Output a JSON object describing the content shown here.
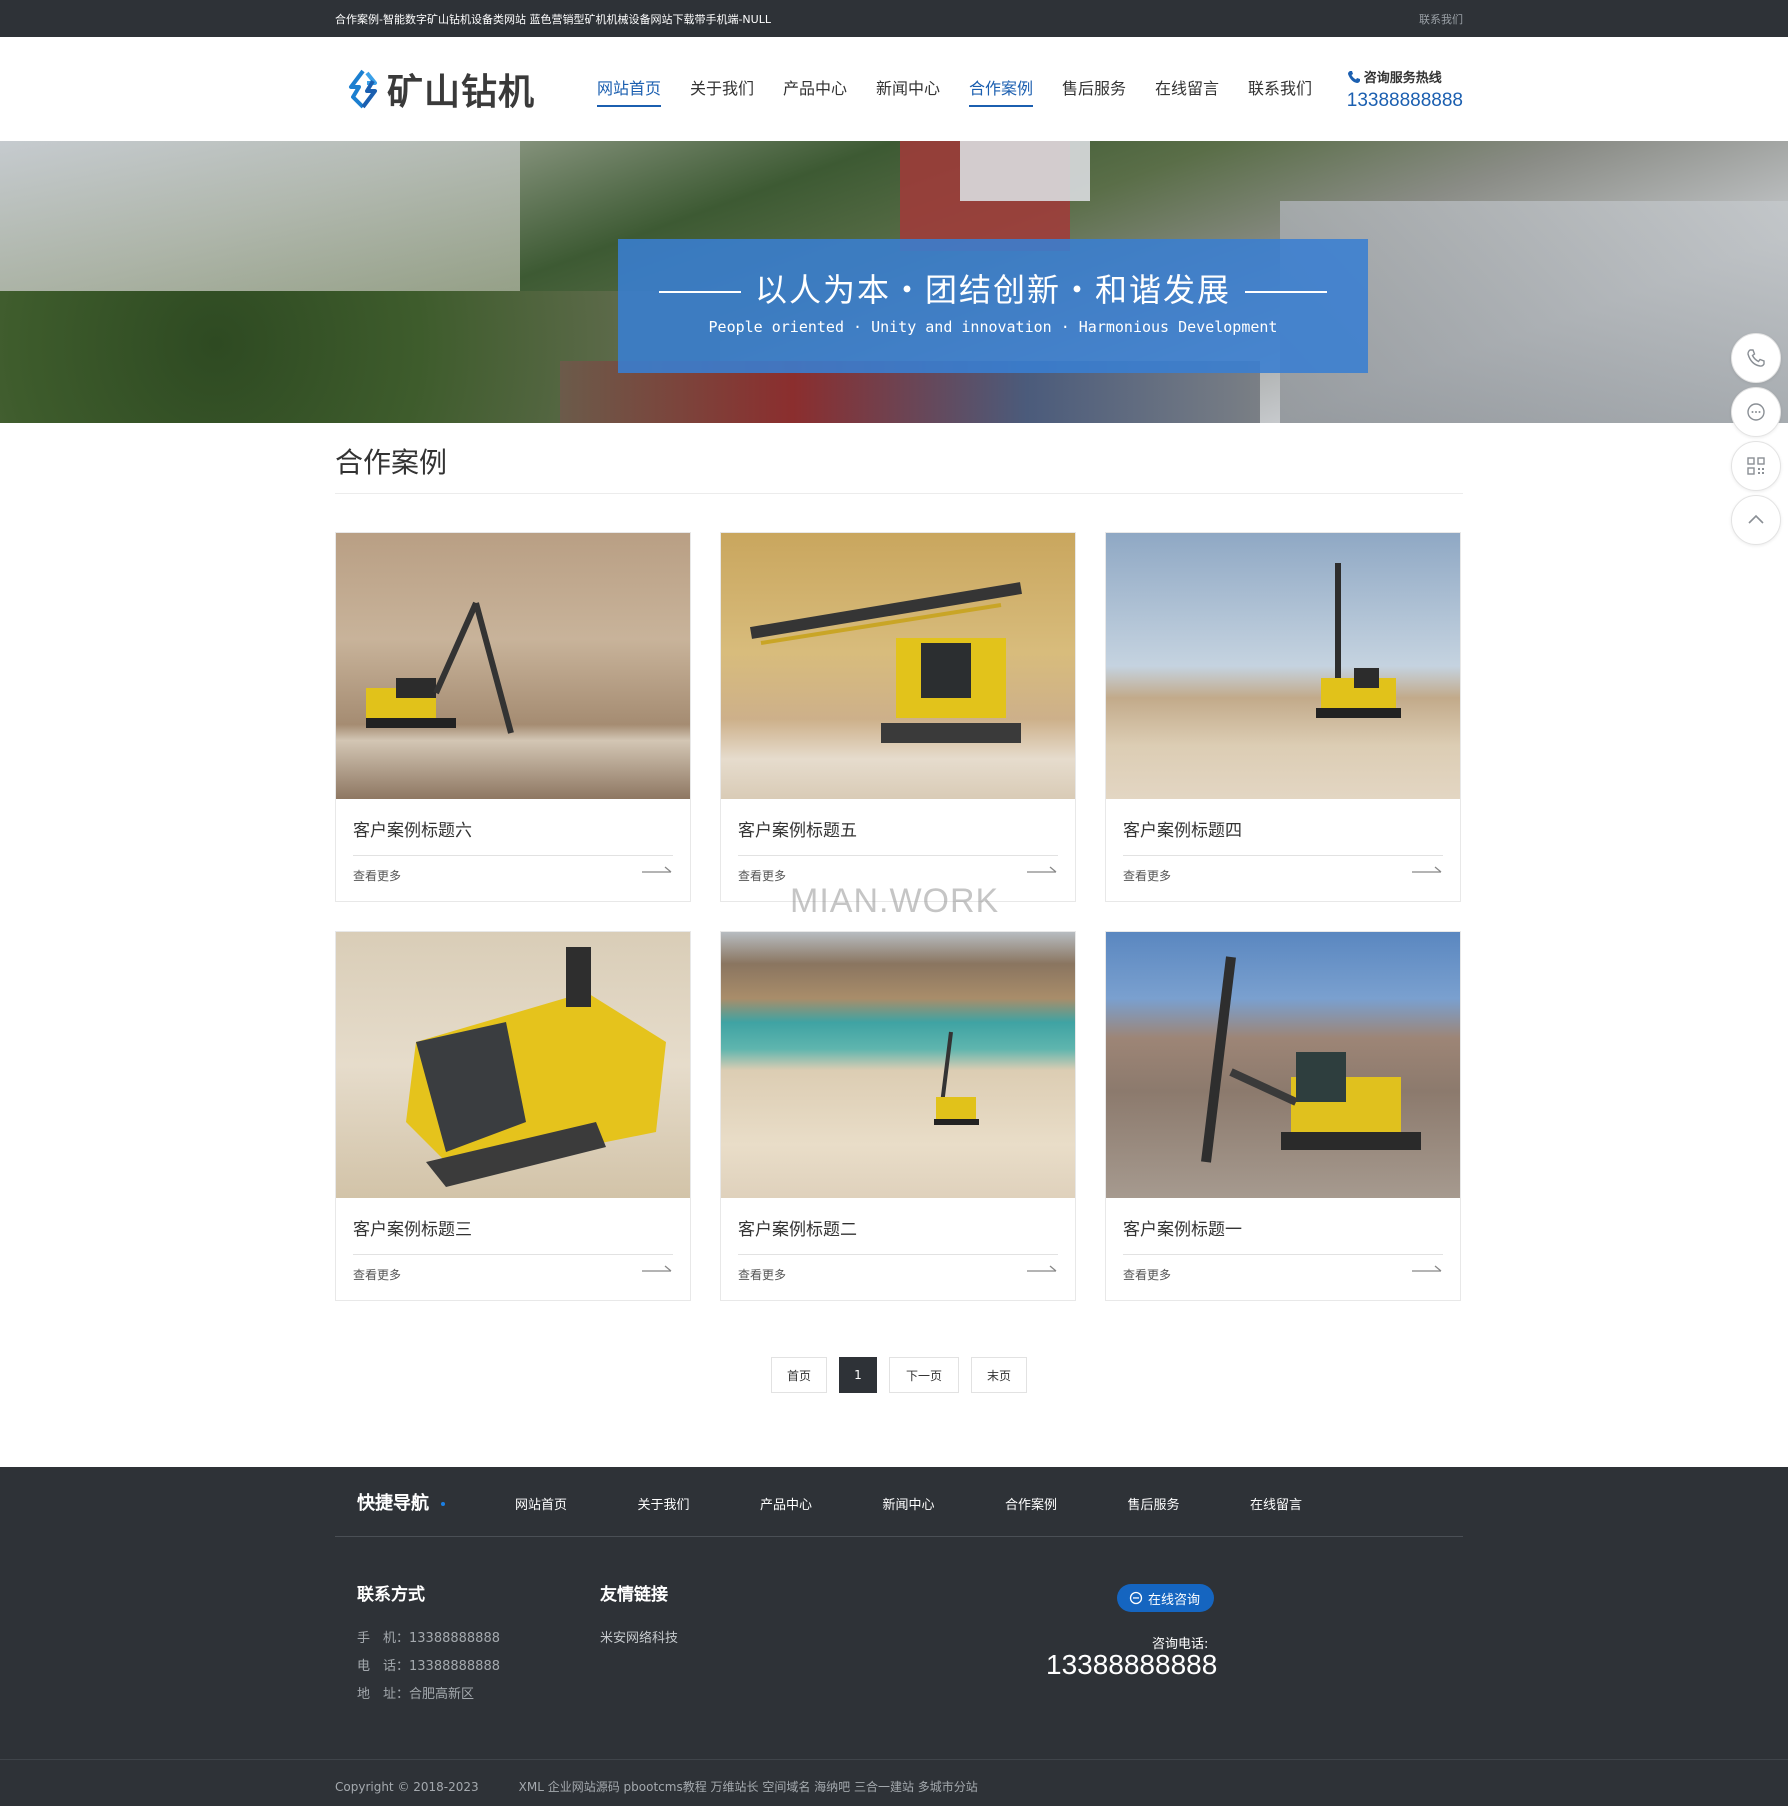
{
  "topbar": {
    "site_title": "合作案例-智能数字矿山钻机设备类网站 蓝色营销型矿机机械设备网站下载带手机端-NULL",
    "contact_link": "联系我们"
  },
  "header": {
    "logo_text": "矿山钻机",
    "nav": [
      {
        "label": "网站首页",
        "active": true
      },
      {
        "label": "关于我们",
        "active": false
      },
      {
        "label": "产品中心",
        "active": false
      },
      {
        "label": "新闻中心",
        "active": false
      },
      {
        "label": "合作案例",
        "active": true
      },
      {
        "label": "售后服务",
        "active": false
      },
      {
        "label": "在线留言",
        "active": false
      },
      {
        "label": "联系我们",
        "active": false
      }
    ],
    "hotline_label": "咨询服务热线",
    "hotline_number": "13388888888",
    "accent_color": "#1b5fb0"
  },
  "banner": {
    "slogan": "以人为本・团结创新・和谐发展",
    "slogan_en": "People oriented · Unity and innovation · Harmonious Development",
    "panel_color": "#397ed2"
  },
  "float_buttons": [
    "phone-icon",
    "chat-icon",
    "qrcode-icon",
    "back-to-top-icon"
  ],
  "main": {
    "section_title": "合作案例",
    "cards": [
      {
        "title": "客户案例标题六",
        "more": "查看更多",
        "scene": "cliff"
      },
      {
        "title": "客户案例标题五",
        "more": "查看更多",
        "scene": "closeup"
      },
      {
        "title": "客户案例标题四",
        "more": "查看更多",
        "scene": "sky"
      },
      {
        "title": "客户案例标题三",
        "more": "查看更多",
        "scene": "cab"
      },
      {
        "title": "客户案例标题二",
        "more": "查看更多",
        "scene": "lake"
      },
      {
        "title": "客户案例标题一",
        "more": "查看更多",
        "scene": "rock"
      }
    ],
    "watermark": "MIAN.WORK"
  },
  "pagination": {
    "first": "首页",
    "current": "1",
    "next": "下一页",
    "last": "末页"
  },
  "footer": {
    "quick_nav_title": "快捷导航",
    "quick_nav": [
      "网站首页",
      "关于我们",
      "产品中心",
      "新闻中心",
      "合作案例",
      "售后服务",
      "在线留言"
    ],
    "contact_title": "联系方式",
    "contact_lines": [
      "手　机：13388888888",
      "电　话：13388888888",
      "地　址：合肥高新区"
    ],
    "friend_title": "友情链接",
    "friend_link": "米安网络科技",
    "online_button": "在线咨询",
    "tel_label": "咨询电话:",
    "tel_number": "13388888888",
    "copyright": "Copyright © 2018-2023",
    "bottom_links": "XML 企业网站源码 pbootcms教程 万维站长 空间域名 海纳吧 三合一建站 多城市分站",
    "bg_color": "#2e3237"
  }
}
